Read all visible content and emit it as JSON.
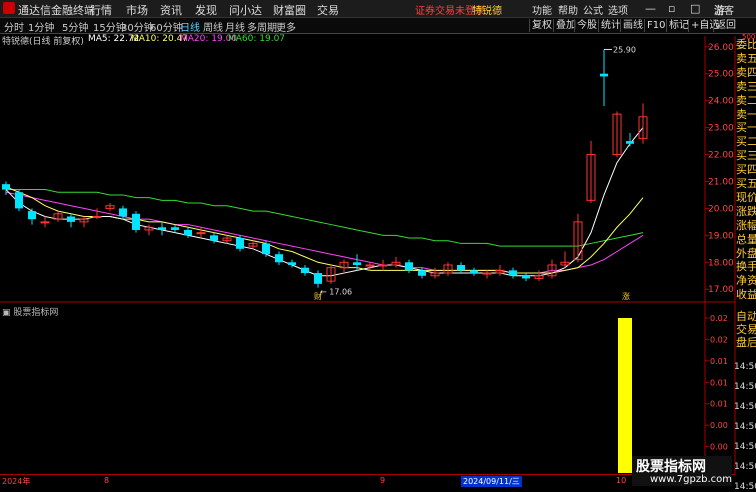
{
  "app": {
    "name": "通达信金融终端",
    "notice": "证券交易未登录",
    "stock": "特锐德",
    "guest": "游客"
  },
  "top_menu": [
    "行情",
    "市场",
    "资讯",
    "发现",
    "问小达",
    "财富圈",
    "交易"
  ],
  "right_menu": [
    "功能",
    "帮助",
    "公式",
    "选项"
  ],
  "period_tabs": [
    "分时",
    "1分钟",
    "5分钟",
    "15分钟",
    "30分钟",
    "60分钟",
    "日线",
    "周线",
    "月线",
    "多周期",
    "更多"
  ],
  "active_tab": "日线",
  "right_buttons": [
    "复权",
    "叠加",
    "今股",
    "统计",
    "画线",
    "F10",
    "标记",
    "+自选",
    "返回"
  ],
  "ma_header": {
    "title": "特锐德(日线 前复权)",
    "ma5": "MA5: 22.72",
    "ma10": "MA10: 20.47",
    "ma20": "MA20: 19.00",
    "ma60": "MA60: 19.07",
    "colors": {
      "ma5": "#ffffff",
      "ma10": "#ffff66",
      "ma20": "#ff44ff",
      "ma60": "#33dd33"
    }
  },
  "price_axis": {
    "top_label": "500",
    "ticks": [
      "26.00",
      "25.00",
      "24.00",
      "23.00",
      "22.00",
      "21.00",
      "20.00",
      "19.00",
      "18.00",
      "17.00"
    ]
  },
  "side_labels": [
    "委比",
    "卖五",
    "卖四",
    "卖三",
    "卖二",
    "卖一",
    "买一",
    "买二",
    "买三",
    "买四",
    "买五",
    "现价",
    "涨跌",
    "涨幅",
    "总量",
    "外盘",
    "换手",
    "净资",
    "收益",
    "自动",
    "交易",
    "盘后"
  ],
  "price_annotations": {
    "high": "25.90",
    "low": "17.06",
    "marker_cai": "财",
    "marker_zhang": "涨"
  },
  "sub_header": "股票指标网",
  "sub_axis": [
    "0.02",
    "0.02",
    "0.01",
    "0.01",
    "0.01",
    "0.00",
    "0.00",
    "0.00"
  ],
  "side_times": [
    "14:50",
    "14:50",
    "14:50",
    "14:50",
    "14:50",
    "14:50",
    "14:50"
  ],
  "dates": [
    "2024年",
    "8",
    "9",
    "2024/09/11/三",
    "10"
  ],
  "watermark": {
    "title": "股票指标网",
    "url": "www.7gpzb.com"
  },
  "chart_data": {
    "type": "candlestick",
    "ylim": [
      16.6,
      26.4
    ],
    "candles": [
      [
        20.9,
        20.7,
        21.0,
        20.5
      ],
      [
        20.6,
        20.0,
        20.7,
        19.9
      ],
      [
        19.9,
        19.6,
        20.0,
        19.4
      ],
      [
        19.5,
        19.5,
        19.7,
        19.3
      ],
      [
        19.6,
        19.8,
        19.9,
        19.5
      ],
      [
        19.7,
        19.5,
        19.8,
        19.3
      ],
      [
        19.5,
        19.6,
        19.7,
        19.3
      ],
      [
        19.7,
        19.7,
        20.0,
        19.6
      ],
      [
        20.0,
        20.1,
        20.2,
        19.9
      ],
      [
        20.0,
        19.7,
        20.1,
        19.6
      ],
      [
        19.8,
        19.2,
        19.9,
        19.1
      ],
      [
        19.2,
        19.3,
        19.4,
        19.0
      ],
      [
        19.3,
        19.2,
        19.5,
        19.0
      ],
      [
        19.3,
        19.2,
        19.4,
        19.1
      ],
      [
        19.2,
        19.0,
        19.3,
        18.9
      ],
      [
        19.1,
        19.1,
        19.3,
        18.9
      ],
      [
        19.0,
        18.8,
        19.1,
        18.7
      ],
      [
        18.8,
        18.9,
        19.0,
        18.7
      ],
      [
        18.9,
        18.5,
        19.0,
        18.4
      ],
      [
        18.6,
        18.7,
        18.8,
        18.5
      ],
      [
        18.7,
        18.3,
        18.8,
        18.2
      ],
      [
        18.3,
        18.0,
        18.4,
        17.9
      ],
      [
        18.0,
        17.9,
        18.1,
        17.8
      ],
      [
        17.8,
        17.6,
        17.9,
        17.5
      ],
      [
        17.6,
        17.2,
        17.7,
        17.06
      ],
      [
        17.3,
        17.8,
        17.9,
        17.2
      ],
      [
        17.8,
        18.0,
        18.1,
        17.6
      ],
      [
        18.0,
        17.9,
        18.3,
        17.7
      ],
      [
        17.9,
        17.9,
        18.0,
        17.7
      ],
      [
        17.9,
        17.9,
        18.1,
        17.7
      ],
      [
        17.9,
        18.0,
        18.2,
        17.8
      ],
      [
        18.0,
        17.7,
        18.1,
        17.6
      ],
      [
        17.7,
        17.5,
        17.8,
        17.4
      ],
      [
        17.5,
        17.6,
        17.8,
        17.4
      ],
      [
        17.6,
        17.9,
        18.0,
        17.5
      ],
      [
        17.9,
        17.7,
        18.0,
        17.6
      ],
      [
        17.7,
        17.6,
        17.8,
        17.5
      ],
      [
        17.6,
        17.6,
        17.7,
        17.4
      ],
      [
        17.6,
        17.7,
        17.9,
        17.5
      ],
      [
        17.7,
        17.5,
        17.8,
        17.4
      ],
      [
        17.5,
        17.4,
        17.6,
        17.3
      ],
      [
        17.4,
        17.5,
        17.7,
        17.3
      ],
      [
        17.5,
        17.9,
        18.1,
        17.4
      ],
      [
        17.9,
        18.0,
        18.4,
        17.8
      ],
      [
        18.1,
        19.5,
        19.8,
        18.0
      ],
      [
        20.3,
        22.0,
        22.5,
        20.2
      ],
      [
        25.0,
        24.9,
        25.9,
        23.8
      ],
      [
        22.0,
        23.5,
        23.6,
        21.9
      ],
      [
        22.5,
        22.4,
        22.8,
        22.3
      ],
      [
        22.6,
        23.4,
        23.9,
        22.4
      ]
    ],
    "ma_lines": {
      "ma5": [
        20.7,
        20.2,
        19.9,
        19.7,
        19.6,
        19.6,
        19.6,
        19.7,
        19.7,
        19.6,
        19.4,
        19.3,
        19.2,
        19.1,
        19.0,
        18.9,
        18.8,
        18.7,
        18.6,
        18.5,
        18.3,
        18.1,
        17.9,
        17.7,
        17.5,
        17.5,
        17.6,
        17.7,
        17.8,
        17.9,
        17.9,
        17.8,
        17.7,
        17.6,
        17.6,
        17.6,
        17.6,
        17.6,
        17.6,
        17.5,
        17.5,
        17.5,
        17.6,
        17.8,
        18.2,
        19.1,
        20.5,
        21.7,
        22.4,
        23.0
      ],
      "ma10": [
        20.8,
        20.6,
        20.4,
        20.1,
        19.9,
        19.8,
        19.7,
        19.7,
        19.7,
        19.6,
        19.6,
        19.5,
        19.5,
        19.4,
        19.3,
        19.2,
        19.1,
        19.0,
        18.9,
        18.8,
        18.7,
        18.5,
        18.4,
        18.2,
        18.0,
        17.9,
        17.8,
        17.8,
        17.7,
        17.7,
        17.7,
        17.7,
        17.7,
        17.7,
        17.7,
        17.7,
        17.7,
        17.7,
        17.7,
        17.6,
        17.6,
        17.6,
        17.6,
        17.7,
        17.8,
        18.2,
        18.7,
        19.3,
        19.8,
        20.4
      ],
      "ma20": [
        20.6,
        20.5,
        20.4,
        20.3,
        20.2,
        20.1,
        20.0,
        19.9,
        19.8,
        19.7,
        19.6,
        19.6,
        19.5,
        19.4,
        19.4,
        19.3,
        19.2,
        19.1,
        19.0,
        18.9,
        18.8,
        18.7,
        18.6,
        18.5,
        18.4,
        18.3,
        18.2,
        18.1,
        18.0,
        17.9,
        17.9,
        17.8,
        17.8,
        17.7,
        17.7,
        17.7,
        17.7,
        17.7,
        17.7,
        17.6,
        17.6,
        17.6,
        17.7,
        17.7,
        17.8,
        17.9,
        18.1,
        18.4,
        18.7,
        19.0
      ],
      "ma60": [
        20.7,
        20.7,
        20.7,
        20.7,
        20.6,
        20.6,
        20.6,
        20.6,
        20.5,
        20.5,
        20.4,
        20.4,
        20.3,
        20.3,
        20.2,
        20.2,
        20.1,
        20.1,
        20.0,
        19.9,
        19.9,
        19.8,
        19.7,
        19.6,
        19.5,
        19.4,
        19.3,
        19.2,
        19.1,
        19.0,
        19.0,
        18.9,
        18.9,
        18.8,
        18.8,
        18.7,
        18.7,
        18.7,
        18.6,
        18.6,
        18.6,
        18.6,
        18.6,
        18.6,
        18.6,
        18.7,
        18.8,
        18.9,
        19.0,
        19.1
      ]
    },
    "indicator_bar": {
      "index": 47,
      "value": 0.02
    }
  }
}
